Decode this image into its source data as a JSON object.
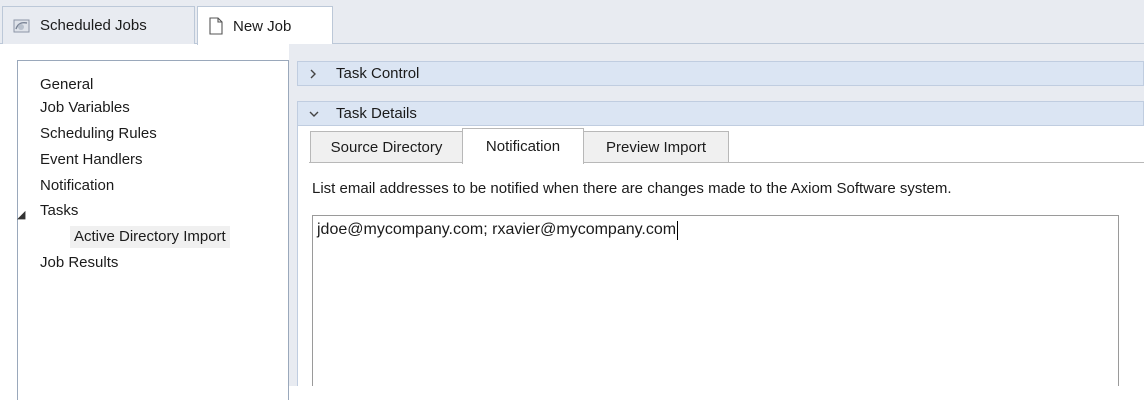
{
  "doc_tabs": [
    {
      "label": "Scheduled Jobs",
      "icon": "scheduled-jobs-icon",
      "active": false
    },
    {
      "label": "New Job",
      "icon": "document-icon",
      "active": true
    }
  ],
  "nav": {
    "items": [
      {
        "label": "General"
      },
      {
        "label": "Job Variables"
      },
      {
        "label": "Scheduling Rules"
      },
      {
        "label": "Event Handlers"
      },
      {
        "label": "Notification"
      },
      {
        "label": "Tasks",
        "expanded": true
      },
      {
        "label": "Active Directory Import",
        "selected": true
      },
      {
        "label": "Job Results"
      }
    ]
  },
  "sections": {
    "task_control": {
      "label": "Task Control",
      "expanded": false
    },
    "task_details": {
      "label": "Task Details",
      "expanded": true
    }
  },
  "inner_tabs": [
    {
      "label": "Source Directory",
      "active": false
    },
    {
      "label": "Notification",
      "active": true
    },
    {
      "label": "Preview Import",
      "active": false
    }
  ],
  "notification": {
    "instructions": "List email addresses to be notified when there are changes made to the Axiom Software system.",
    "emails_value": "jdoe@mycompany.com; rxavier@mycompany.com"
  },
  "colors": {
    "tab_strip_bg": "#e8ebf1",
    "section_header_bg": "#dbe5f3",
    "selected_item_bg": "#f0f0f0"
  }
}
